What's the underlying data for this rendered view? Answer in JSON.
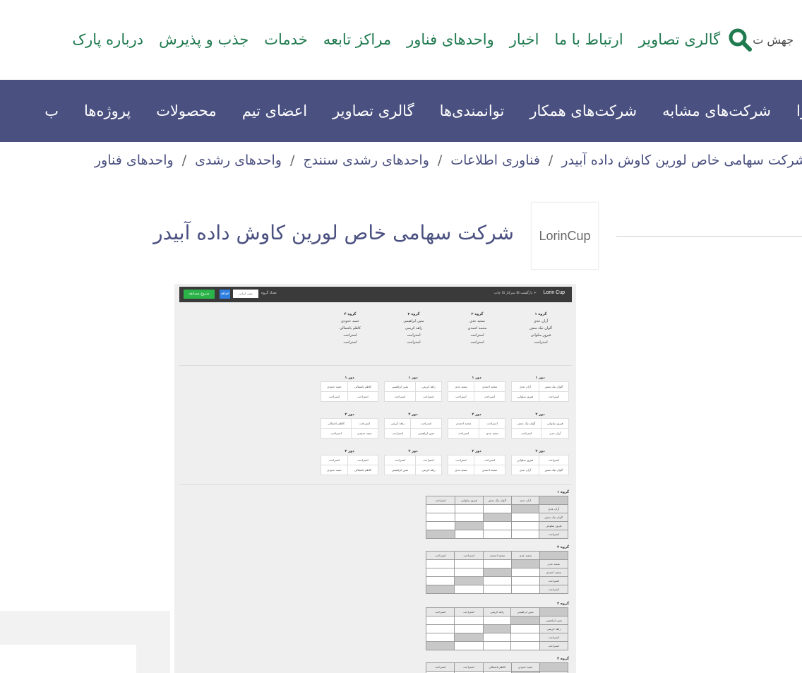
{
  "top_nav": {
    "items": [
      "درباره پارک",
      "جذب و پذیرش",
      "خدمات",
      "مراکز تابعه",
      "واحدهای فناور",
      "اخبار",
      "ارتباط با ما",
      "گالری تصاویر"
    ],
    "search_icon": "search-icon",
    "jump_label": "جهش ت"
  },
  "purple_nav": {
    "items": [
      "ب",
      "پروژه‌ها",
      "محصولات",
      "اعضای تیم",
      "گالری تصاویر",
      "توانمندی‌ها",
      "شرکت‌های همکار",
      "شرکت‌های مشابه",
      "را"
    ]
  },
  "breadcrumb": {
    "items": [
      "واحدهای فناور",
      "واحدهای رشدی",
      "واحدهای رشدی سنندج",
      "فناوری اطلاعات",
      "شرکت سهامی خاص لورین کاوش داده آبیدر"
    ],
    "separator": "/"
  },
  "company": {
    "logo_text": "LorinCup",
    "title": "شرکت سهامی خاص لورین کاوش داده آبیدر"
  },
  "screenshot": {
    "logo": "Lorin Cup",
    "menu": "+ بازگشت   ⊞ سرکار   ⊟ چاپ",
    "green_button": "شروع مسابقه",
    "blue_button": "اضافه",
    "input_placeholder": "تیمی ایرانی",
    "input_label": "تعداد گروه",
    "groups": [
      {
        "title": "گروه ۱",
        "members": [
          "آران عدی",
          "آلوان تیک منش",
          "فیروز سلوانی",
          "استراحت"
        ]
      },
      {
        "title": "گروه ۲",
        "members": [
          "سعید عدی",
          "محمد احمدی",
          "استراحت",
          "استراحت"
        ]
      },
      {
        "title": "گروه ۳",
        "members": [
          "متین ابراهیمی",
          "زاهد کریمی",
          "استراحت",
          "استراحت"
        ]
      },
      {
        "title": "گروه ۴",
        "members": [
          "حمید حدودی",
          "کاظم باشمالی",
          "استراحت",
          "استراحت"
        ]
      }
    ],
    "round_labels": [
      "دور ۱",
      "دور ۲",
      "دور ۳"
    ],
    "table_titles": [
      "گروه ۱",
      "گروه ۲",
      "گروه ۳",
      "گروه ۴"
    ]
  },
  "colors": {
    "nav_green": "#1f7a4f",
    "purple_bar": "#4a5080",
    "title": "#4a5080"
  }
}
